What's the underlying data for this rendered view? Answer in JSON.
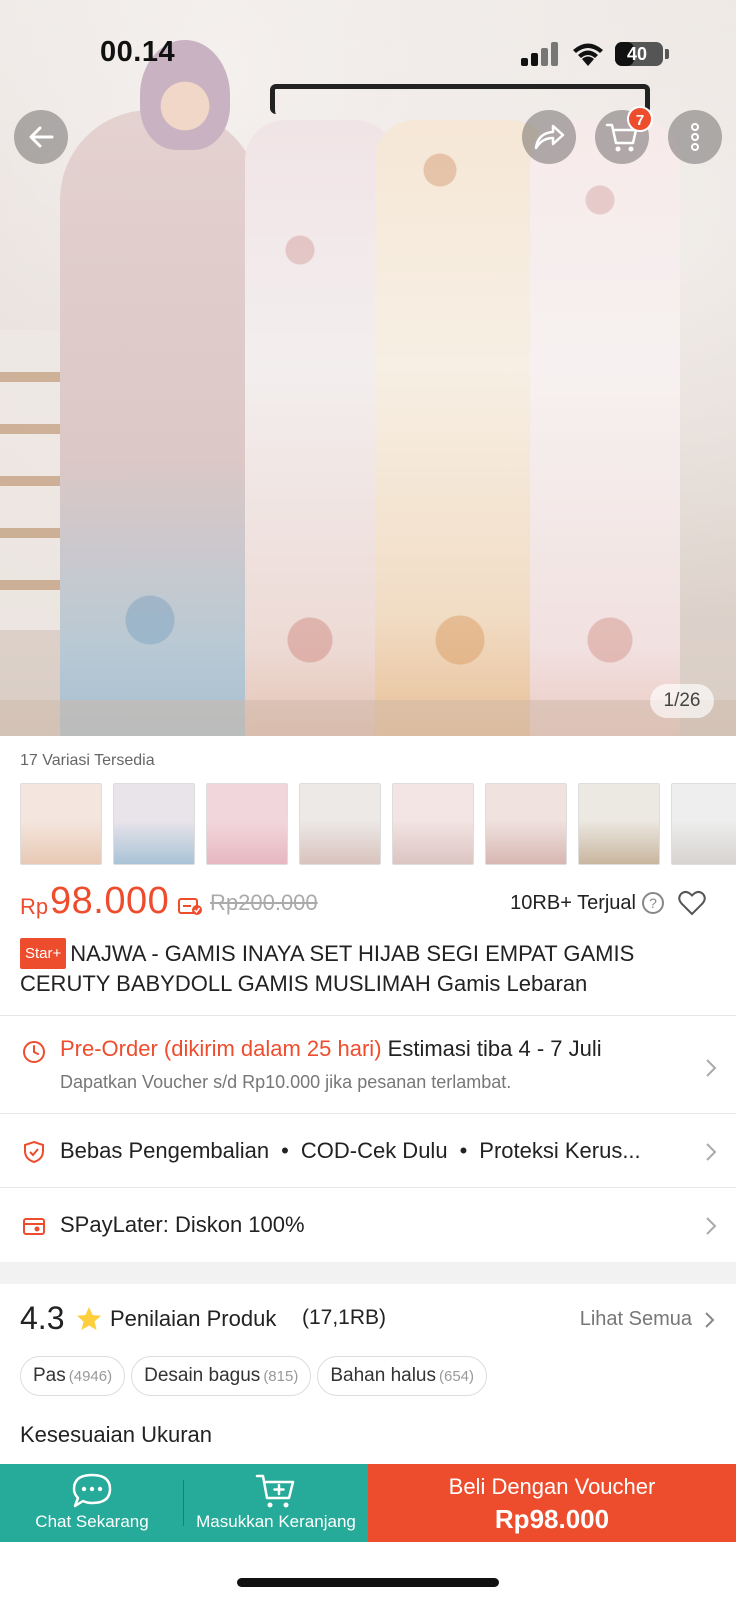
{
  "status_bar": {
    "time": "00.14",
    "battery": "40",
    "battery_level": 0.4
  },
  "header": {
    "cart_badge": "7",
    "image_counter": "1/26",
    "icons": [
      "back-arrow-icon",
      "share-icon",
      "cart-icon",
      "more-vertical-icon"
    ]
  },
  "variants": {
    "label": "17 Variasi Tersedia",
    "thumbs": [
      {
        "colors": [
          "#f4e6de",
          "#e8c9b5"
        ]
      },
      {
        "colors": [
          "#e9e4ea",
          "#a9c3d6"
        ]
      },
      {
        "colors": [
          "#f1d7dc",
          "#e7b7c1"
        ]
      },
      {
        "colors": [
          "#ece9e7",
          "#d9c3bd"
        ]
      },
      {
        "colors": [
          "#f2e5e3",
          "#dcc4c2"
        ]
      },
      {
        "colors": [
          "#efe2df",
          "#d8b7b2"
        ]
      },
      {
        "colors": [
          "#ece8e2",
          "#c9b69f"
        ]
      },
      {
        "colors": [
          "#eeeeee",
          "#d7d3d0"
        ]
      }
    ]
  },
  "price": {
    "currency": "Rp",
    "current": "98.000",
    "original": "Rp200.000",
    "sold": "10RB+ Terjual"
  },
  "product": {
    "badge": "Star+",
    "title": "NAJWA - GAMIS INAYA SET HIJAB SEGI EMPAT GAMIS CERUTY BABYDOLL GAMIS MUSLIMAH Gamis Lebaran"
  },
  "shipping": {
    "preorder": "Pre-Order (dikirim dalam 25 hari)",
    "estimate": "Estimasi tiba 4 - 7 Juli",
    "voucher_note": "Dapatkan Voucher s/d Rp10.000 jika pesanan terlambat."
  },
  "perks": [
    "Bebas Pengembalian",
    "COD-Cek Dulu",
    "Proteksi Kerus..."
  ],
  "spaylater": "SPayLater: Diskon 100%",
  "rating": {
    "value": "4.3",
    "label": "Penilaian Produk",
    "count": "(17,1RB)",
    "see_all": "Lihat Semua",
    "chips": [
      {
        "label": "Pas",
        "count": "(4946)"
      },
      {
        "label": "Desain bagus",
        "count": "(815)"
      },
      {
        "label": "Bahan halus",
        "count": "(654)"
      }
    ]
  },
  "fit_section": {
    "title": "Kesesuaian Ukuran"
  },
  "bottom_bar": {
    "chat": "Chat Sekarang",
    "add_to_cart": "Masukkan Keranjang",
    "buy": "Beli Dengan Voucher",
    "buy_price": "Rp98.000"
  },
  "colors": {
    "brand_orange": "#ee4d2d",
    "teal": "#26aa99"
  }
}
